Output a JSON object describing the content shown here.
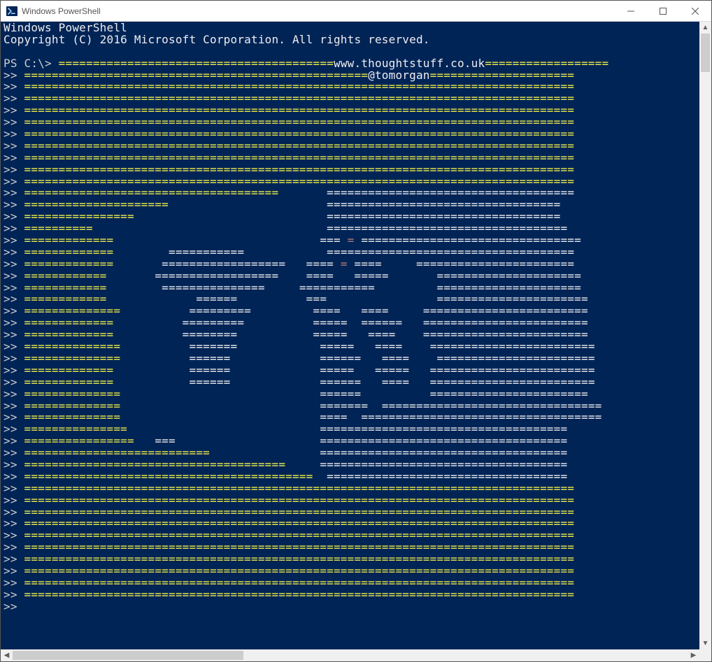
{
  "window": {
    "title": "Windows PowerShell"
  },
  "console": {
    "header_line1": "Windows PowerShell",
    "header_line2": "Copyright (C) 2016 Microsoft Corporation. All rights reserved.",
    "prompt_first": "PS C:\\>",
    "prompt_cont": ">>",
    "url_insert": "www.thoughtstuff.co.uk",
    "handle_insert": "@tomorgan",
    "art": [
      {
        "pos": 40,
        "pre": 40,
        "highlight": "url",
        "post": 18
      },
      {
        "pos": 50,
        "pre": 50,
        "highlight": "handle",
        "post": 21
      },
      {
        "full": 80
      },
      {
        "full": 80
      },
      {
        "full": 80
      },
      {
        "full": 80
      },
      {
        "full": 80
      },
      {
        "full": 80
      },
      {
        "full": 80
      },
      {
        "full": 80
      },
      {
        "full": 80
      },
      {
        "segs": [
          {
            "c": "y",
            "t": "====================================="
          },
          {
            "c": "w",
            "t": "       "
          },
          {
            "c": "w",
            "t": "===================================="
          }
        ]
      },
      {
        "segs": [
          {
            "c": "y",
            "t": "====================="
          },
          {
            "c": "w",
            "t": "                       "
          },
          {
            "c": "w",
            "t": "=================================="
          }
        ]
      },
      {
        "segs": [
          {
            "c": "y",
            "t": "================"
          },
          {
            "c": "w",
            "t": "                            "
          },
          {
            "c": "w",
            "t": "=================================="
          }
        ]
      },
      {
        "segs": [
          {
            "c": "y",
            "t": "=========="
          },
          {
            "c": "w",
            "t": "                                  "
          },
          {
            "c": "w",
            "t": "==================================="
          }
        ]
      },
      {
        "segs": [
          {
            "c": "y",
            "t": "============="
          },
          {
            "c": "w",
            "t": "                              "
          },
          {
            "c": "w",
            "t": "==="
          },
          {
            "c": "s",
            "t": " = "
          },
          {
            "c": "w",
            "t": "================================"
          }
        ]
      },
      {
        "segs": [
          {
            "c": "y",
            "t": "============="
          },
          {
            "c": "w",
            "t": "        "
          },
          {
            "c": "w",
            "t": "==========="
          },
          {
            "c": "w",
            "t": "            ="
          },
          {
            "c": "w",
            "t": "==================================="
          }
        ]
      },
      {
        "segs": [
          {
            "c": "y",
            "t": "============="
          },
          {
            "c": "w",
            "t": "       "
          },
          {
            "c": "w",
            "t": "=================="
          },
          {
            "c": "w",
            "t": "   "
          },
          {
            "c": "w",
            "t": "===="
          },
          {
            "c": "s",
            "t": " = "
          },
          {
            "c": "w",
            "t": "===="
          },
          {
            "c": "w",
            "t": "     "
          },
          {
            "c": "w",
            "t": "======================="
          }
        ]
      },
      {
        "segs": [
          {
            "c": "y",
            "t": "============"
          },
          {
            "c": "w",
            "t": "       "
          },
          {
            "c": "w",
            "t": "=================="
          },
          {
            "c": "w",
            "t": "    "
          },
          {
            "c": "w",
            "t": "===="
          },
          {
            "c": "w",
            "t": "   "
          },
          {
            "c": "w",
            "t": "====="
          },
          {
            "c": "w",
            "t": "       "
          },
          {
            "c": "w",
            "t": "====================="
          }
        ]
      },
      {
        "segs": [
          {
            "c": "y",
            "t": "============"
          },
          {
            "c": "w",
            "t": "        "
          },
          {
            "c": "w",
            "t": "==============="
          },
          {
            "c": "w",
            "t": "     "
          },
          {
            "c": "w",
            "t": "==========="
          },
          {
            "c": "w",
            "t": "         "
          },
          {
            "c": "w",
            "t": "====================="
          }
        ]
      },
      {
        "segs": [
          {
            "c": "y",
            "t": "============"
          },
          {
            "c": "w",
            "t": "             "
          },
          {
            "c": "w",
            "t": "======"
          },
          {
            "c": "w",
            "t": "          "
          },
          {
            "c": "w",
            "t": "==="
          },
          {
            "c": "w",
            "t": "                "
          },
          {
            "c": "w",
            "t": "======================"
          }
        ]
      },
      {
        "segs": [
          {
            "c": "y",
            "t": "=============="
          },
          {
            "c": "w",
            "t": "          "
          },
          {
            "c": "w",
            "t": "========="
          },
          {
            "c": "w",
            "t": "         "
          },
          {
            "c": "w",
            "t": "===="
          },
          {
            "c": "w",
            "t": "   "
          },
          {
            "c": "w",
            "t": "===="
          },
          {
            "c": "w",
            "t": "     "
          },
          {
            "c": "w",
            "t": "========================"
          }
        ]
      },
      {
        "segs": [
          {
            "c": "y",
            "t": "============="
          },
          {
            "c": "w",
            "t": "          "
          },
          {
            "c": "w",
            "t": "========="
          },
          {
            "c": "w",
            "t": "          "
          },
          {
            "c": "w",
            "t": "====="
          },
          {
            "c": "w",
            "t": "  "
          },
          {
            "c": "w",
            "t": "======"
          },
          {
            "c": "w",
            "t": "   "
          },
          {
            "c": "w",
            "t": "========================"
          }
        ]
      },
      {
        "segs": [
          {
            "c": "y",
            "t": "============="
          },
          {
            "c": "w",
            "t": "          "
          },
          {
            "c": "w",
            "t": "========"
          },
          {
            "c": "w",
            "t": "           "
          },
          {
            "c": "w",
            "t": "====="
          },
          {
            "c": "w",
            "t": "   "
          },
          {
            "c": "w",
            "t": "===="
          },
          {
            "c": "w",
            "t": "    "
          },
          {
            "c": "w",
            "t": "========================"
          }
        ]
      },
      {
        "segs": [
          {
            "c": "y",
            "t": "=============="
          },
          {
            "c": "w",
            "t": "          "
          },
          {
            "c": "w",
            "t": "======="
          },
          {
            "c": "w",
            "t": "            "
          },
          {
            "c": "w",
            "t": "====="
          },
          {
            "c": "w",
            "t": "   "
          },
          {
            "c": "w",
            "t": "===="
          },
          {
            "c": "w",
            "t": "    "
          },
          {
            "c": "w",
            "t": "========================"
          }
        ]
      },
      {
        "segs": [
          {
            "c": "y",
            "t": "=============="
          },
          {
            "c": "w",
            "t": "          "
          },
          {
            "c": "w",
            "t": "======"
          },
          {
            "c": "w",
            "t": "             "
          },
          {
            "c": "w",
            "t": "======"
          },
          {
            "c": "w",
            "t": "   "
          },
          {
            "c": "w",
            "t": "===="
          },
          {
            "c": "w",
            "t": "    "
          },
          {
            "c": "w",
            "t": "======================="
          }
        ]
      },
      {
        "segs": [
          {
            "c": "y",
            "t": "============="
          },
          {
            "c": "w",
            "t": "           "
          },
          {
            "c": "w",
            "t": "======"
          },
          {
            "c": "w",
            "t": "             "
          },
          {
            "c": "w",
            "t": "====="
          },
          {
            "c": "w",
            "t": "   "
          },
          {
            "c": "w",
            "t": "====="
          },
          {
            "c": "w",
            "t": "   "
          },
          {
            "c": "w",
            "t": "========================"
          }
        ]
      },
      {
        "segs": [
          {
            "c": "y",
            "t": "============="
          },
          {
            "c": "w",
            "t": "           "
          },
          {
            "c": "w",
            "t": "======"
          },
          {
            "c": "w",
            "t": "             "
          },
          {
            "c": "w",
            "t": "======"
          },
          {
            "c": "w",
            "t": "   "
          },
          {
            "c": "w",
            "t": "===="
          },
          {
            "c": "w",
            "t": "   "
          },
          {
            "c": "w",
            "t": "========================"
          }
        ]
      },
      {
        "segs": [
          {
            "c": "y",
            "t": "=============="
          },
          {
            "c": "w",
            "t": "                             "
          },
          {
            "c": "w",
            "t": "======"
          },
          {
            "c": "w",
            "t": "          "
          },
          {
            "c": "w",
            "t": "======================="
          }
        ]
      },
      {
        "segs": [
          {
            "c": "y",
            "t": "=============="
          },
          {
            "c": "w",
            "t": "                             "
          },
          {
            "c": "w",
            "t": "======="
          },
          {
            "c": "w",
            "t": "  "
          },
          {
            "c": "w",
            "t": "================================"
          }
        ]
      },
      {
        "segs": [
          {
            "c": "y",
            "t": "=============="
          },
          {
            "c": "w",
            "t": "                             "
          },
          {
            "c": "w",
            "t": "===="
          },
          {
            "c": "w",
            "t": "  "
          },
          {
            "c": "w",
            "t": "==================================="
          }
        ]
      },
      {
        "segs": [
          {
            "c": "y",
            "t": "==============="
          },
          {
            "c": "w",
            "t": "                            "
          },
          {
            "c": "w",
            "t": "===================================="
          }
        ]
      },
      {
        "segs": [
          {
            "c": "y",
            "t": "================"
          },
          {
            "c": "w",
            "t": "   "
          },
          {
            "c": "w",
            "t": "==="
          },
          {
            "c": "w",
            "t": "                     "
          },
          {
            "c": "w",
            "t": "===================================="
          }
        ]
      },
      {
        "segs": [
          {
            "c": "y",
            "t": "==========================="
          },
          {
            "c": "w",
            "t": "                "
          },
          {
            "c": "w",
            "t": "===================================="
          }
        ]
      },
      {
        "segs": [
          {
            "c": "y",
            "t": "======================================"
          },
          {
            "c": "w",
            "t": "     "
          },
          {
            "c": "w",
            "t": "===================================="
          }
        ]
      },
      {
        "segs": [
          {
            "c": "y",
            "t": "=========================================="
          },
          {
            "c": "w",
            "t": "  "
          },
          {
            "c": "w",
            "t": "==================================="
          }
        ]
      },
      {
        "full": 80
      },
      {
        "full": 80
      },
      {
        "full": 80
      },
      {
        "full": 80
      },
      {
        "full": 80
      },
      {
        "full": 80
      },
      {
        "full": 80
      },
      {
        "full": 80
      },
      {
        "full": 80
      },
      {
        "full": 80
      },
      {
        "cursor": true
      }
    ]
  },
  "colors": {
    "console_bg": "#012456",
    "text_white": "#eeedf0",
    "text_yellow": "#eeec4b",
    "text_salmon": "#ba7b78",
    "prompt_gray": "#cccccc"
  }
}
